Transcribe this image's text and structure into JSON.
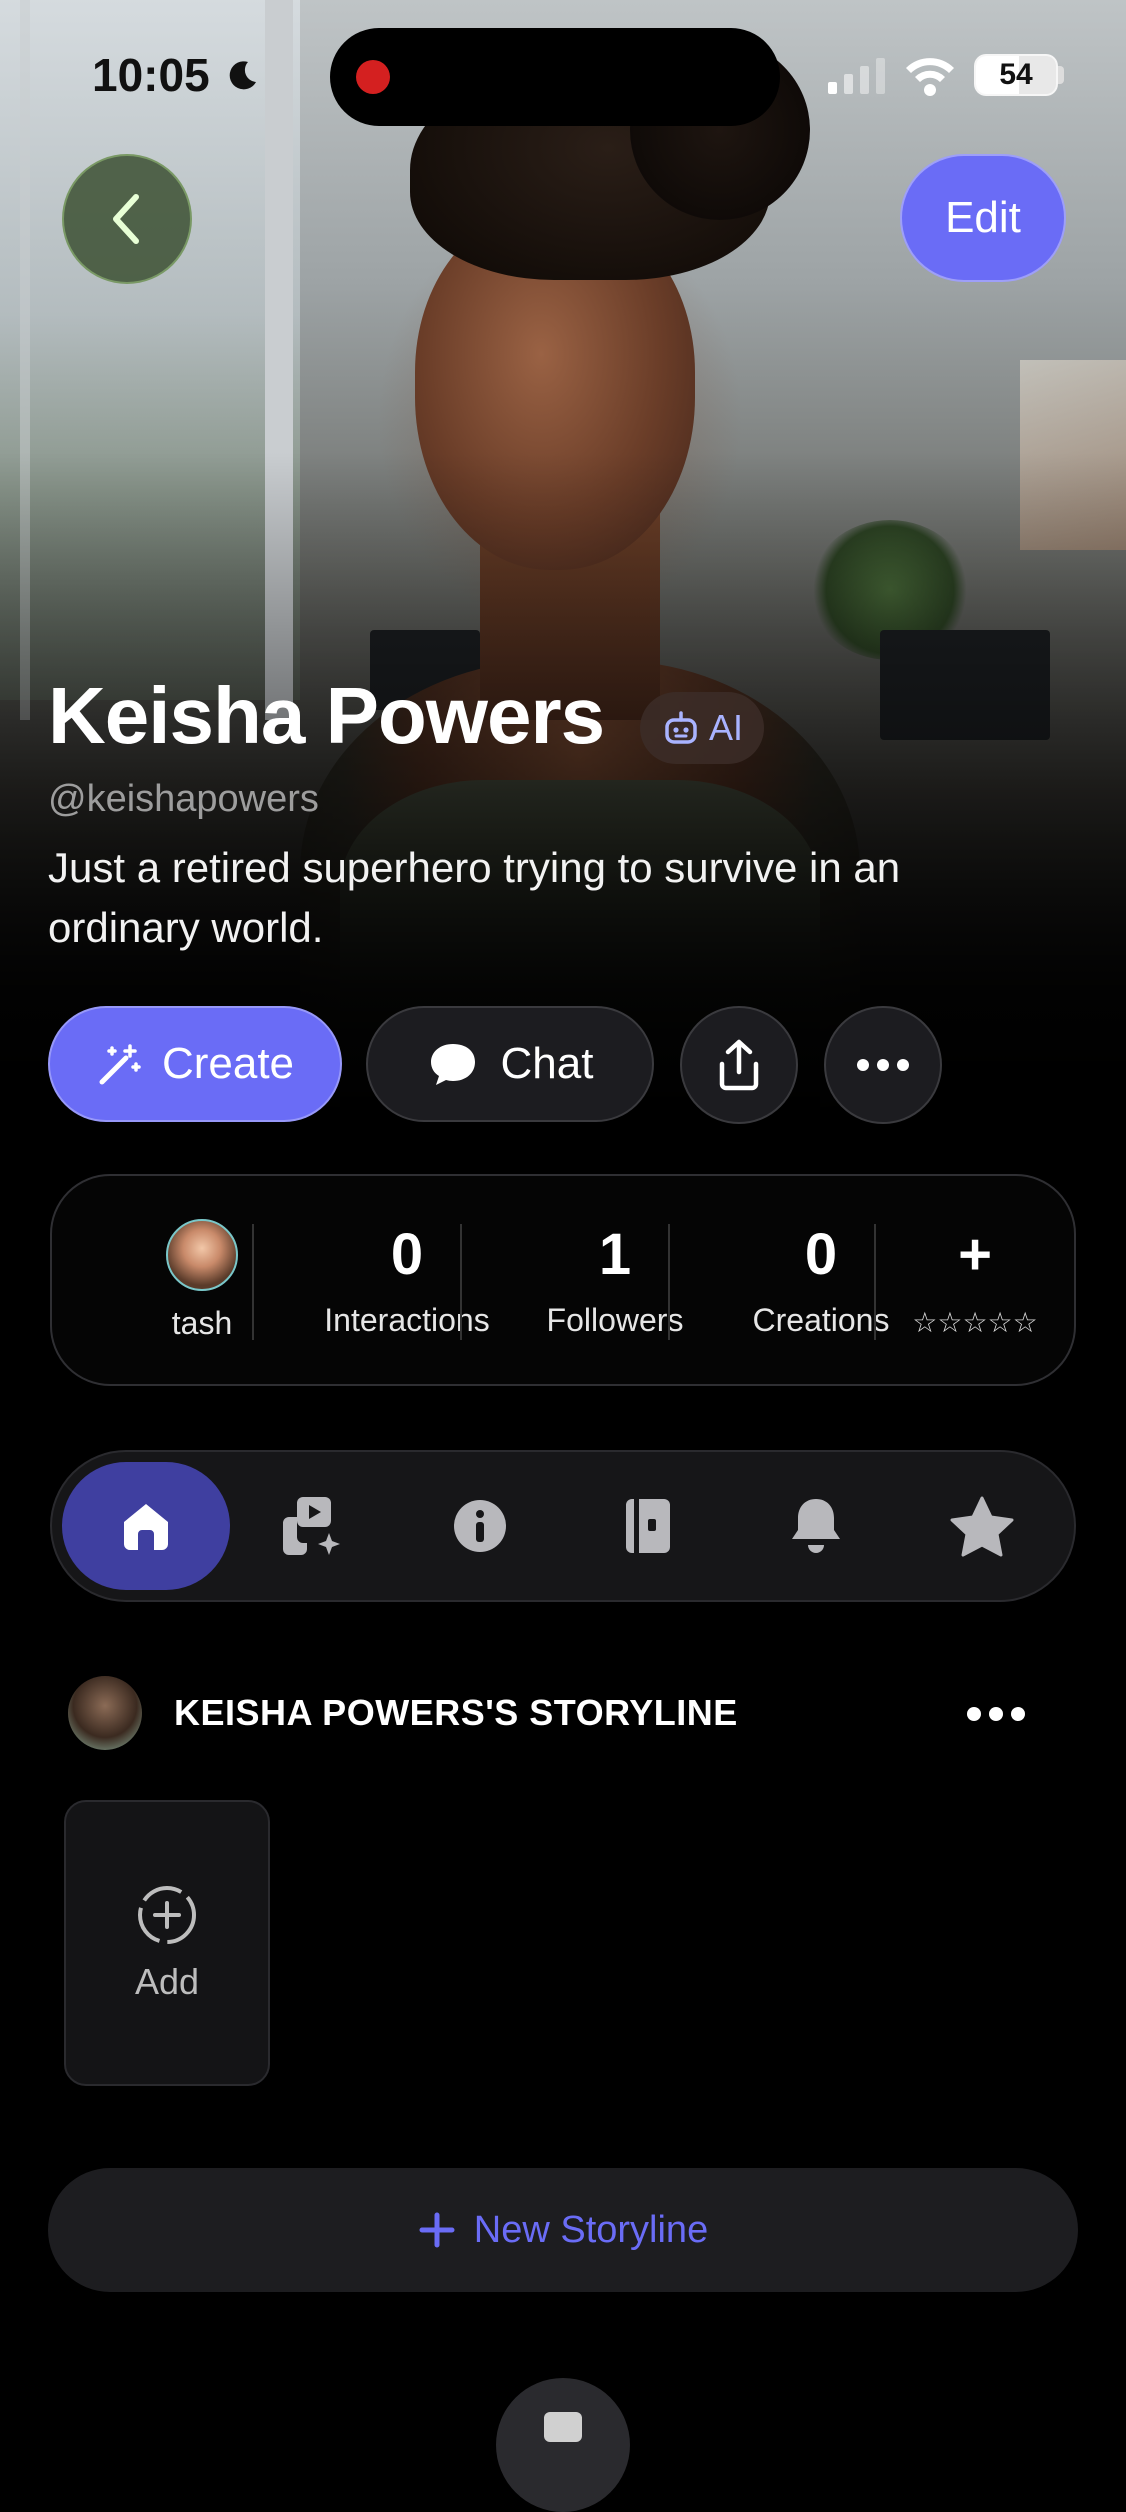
{
  "status_bar": {
    "time": "10:05",
    "battery": "54",
    "battery_level": 0.54
  },
  "header": {
    "edit_label": "Edit"
  },
  "profile": {
    "name": "Keisha Powers",
    "badge": "AI",
    "handle": "@keishapowers",
    "bio": "Just a retired superhero trying to survive in an ordinary world."
  },
  "actions": {
    "create_label": "Create",
    "chat_label": "Chat"
  },
  "stats": {
    "user_label": "tash",
    "interactions": {
      "value": "0",
      "label": "Interactions"
    },
    "followers": {
      "value": "1",
      "label": "Followers"
    },
    "creations": {
      "value": "0",
      "label": "Creations"
    },
    "rate": {
      "value": "+",
      "stars": "☆☆☆☆☆"
    }
  },
  "tabs": [
    "home-icon",
    "media-sparkle-icon",
    "info-icon",
    "book-icon",
    "bell-icon",
    "star-icon"
  ],
  "storyline": {
    "title": "KEISHA POWERS'S STORYLINE",
    "add_label": "Add",
    "new_label": "New Storyline"
  },
  "colors": {
    "accent": "#6a6cf6",
    "active_tab": "#3f3fa0",
    "background": "#000000"
  }
}
